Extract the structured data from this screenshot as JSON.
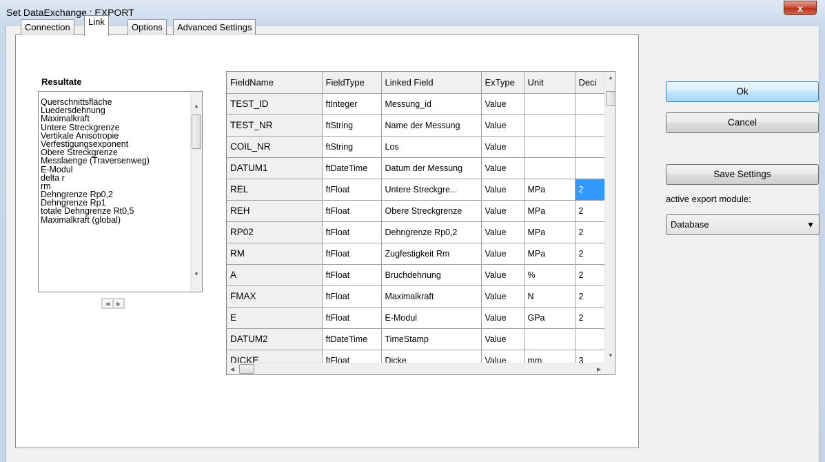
{
  "window": {
    "title": "Set DataExchange : EXPORT",
    "close_glyph": "x"
  },
  "tabs": [
    {
      "label": "Connection",
      "active": false
    },
    {
      "label": "Link",
      "active": true
    },
    {
      "label": "Options",
      "active": false
    },
    {
      "label": "Advanced Settings",
      "active": false
    }
  ],
  "results": {
    "label": "Resultate",
    "items": [
      "Querschnittsfläche",
      "Luedersdehnung",
      "Maximalkraft",
      "Untere Streckgrenze",
      "Vertikale Anisotropie",
      "Verfestigungsexponent",
      "Obere Streckgrenze",
      "Messlaenge (Traversenweg)",
      "E-Modul",
      "delta r",
      "rm",
      "Dehngrenze Rp0,2",
      "Dehngrenze Rp1",
      "totale Dehngrenze Rt0,5",
      "Maximalkraft (global)"
    ]
  },
  "grid": {
    "columns": [
      "FieldName",
      "FieldType",
      "Linked Field",
      "ExType",
      "Unit",
      "Deci"
    ],
    "rows": [
      [
        "TEST_ID",
        "ftInteger",
        "Messung_id",
        "Value",
        "",
        ""
      ],
      [
        "TEST_NR",
        "ftString",
        "Name der Messung",
        "Value",
        "",
        ""
      ],
      [
        "COIL_NR",
        "ftString",
        "Los",
        "Value",
        "",
        ""
      ],
      [
        "DATUM1",
        "ftDateTime",
        "Datum der Messung",
        "Value",
        "",
        ""
      ],
      [
        "REL",
        "ftFloat",
        "Untere Streckgre...",
        "Value",
        "MPa",
        "2"
      ],
      [
        "REH",
        "ftFloat",
        "Obere Streckgrenze",
        "Value",
        "MPa",
        "2"
      ],
      [
        "RP02",
        "ftFloat",
        "Dehngrenze Rp0,2",
        "Value",
        "MPa",
        "2"
      ],
      [
        "RM",
        "ftFloat",
        "Zugfestigkeit Rm",
        "Value",
        "MPa",
        "2"
      ],
      [
        "A",
        "ftFloat",
        "Bruchdehnung",
        "Value",
        "%",
        "2"
      ],
      [
        "FMAX",
        "ftFloat",
        "Maximalkraft",
        "Value",
        "N",
        "2"
      ],
      [
        "E",
        "ftFloat",
        "E-Modul",
        "Value",
        "GPa",
        "2"
      ],
      [
        "DATUM2",
        "ftDateTime",
        "TimeStamp",
        "Value",
        "",
        ""
      ],
      [
        "DICKE",
        "ftFloat",
        "Dicke",
        "Value",
        "mm",
        "3"
      ]
    ],
    "selected_cell": {
      "row": 4,
      "col": 5
    }
  },
  "actions": {
    "ok_label": "Ok",
    "cancel_label": "Cancel",
    "save_label": "Save Settings"
  },
  "export_module": {
    "label": "active export module:",
    "selected": "Database"
  },
  "icons": {
    "close": "close-icon",
    "scroll_up": "scroll-up-arrow-icon",
    "scroll_down": "scroll-down-arrow-icon",
    "scroll_left": "scroll-left-arrow-icon",
    "scroll_right": "scroll-right-arrow-icon",
    "dropdown": "chevron-down-icon"
  },
  "colors": {
    "selection": "#3399ff",
    "primary_button": "#bee6fd",
    "close_button": "#c7432f"
  }
}
